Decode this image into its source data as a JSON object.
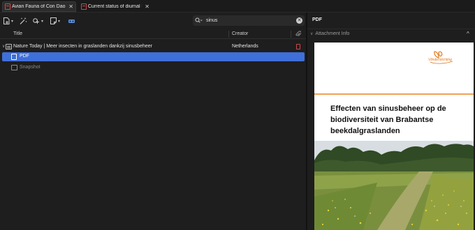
{
  "tabs": [
    {
      "label": "Avian Fauna of Con Dao a",
      "close": "✕",
      "active": true
    },
    {
      "label": "Current status of diurnal b",
      "close": "✕",
      "active": false
    }
  ],
  "toolbar": {
    "new_item_icon": "new-item-icon",
    "add_by_identifier_icon": "magic-wand-icon",
    "attach_icon": "paperclip-icon",
    "note_icon": "note-icon",
    "sync_icon": "sync-icon",
    "caret": "▾"
  },
  "search": {
    "value": "sinus",
    "clear": "✕"
  },
  "columns": {
    "title": "Title",
    "creator": "Creator"
  },
  "items": [
    {
      "title": "Nature Today | Meer insecten in graslanden dankzij sinusbeheer",
      "creator": "Netherlands"
    }
  ],
  "attachments": [
    {
      "title": "PDF",
      "selected": true
    },
    {
      "title": "Snapshot",
      "selected": false
    }
  ],
  "pane": {
    "title": "PDF",
    "section": "Attachment Info",
    "section_chevron": "∨",
    "collapse": "^"
  },
  "document": {
    "logo_text": "Vlinderstichting",
    "heading": "Effecten van sinusbeheer op de biodiversiteit van Brabantse beekdalgraslanden"
  },
  "colors": {
    "accent_blue": "#3f6fd8",
    "pdf_red": "#d04848",
    "orange_rule": "#f0a256",
    "background": "#1e1e1e"
  }
}
